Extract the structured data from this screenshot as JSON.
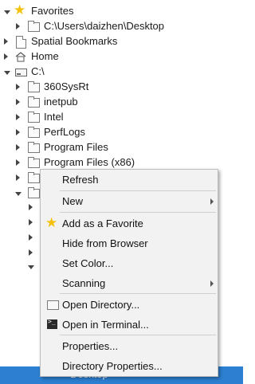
{
  "tree": {
    "favorites_label": "Favorites",
    "desktop_path": "C:\\Users\\daizhen\\Desktop",
    "spatial_bookmarks": "Spatial Bookmarks",
    "home": "Home",
    "drive": "C:\\",
    "folders": [
      "360SysRt",
      "inetpub",
      "Intel",
      "PerfLogs",
      "Program Files",
      "Program Files (x86)"
    ],
    "selected_label": "Desktop"
  },
  "context_menu": {
    "refresh": "Refresh",
    "new": "New",
    "add_favorite": "Add as a Favorite",
    "hide_from_browser": "Hide from Browser",
    "set_color": "Set Color...",
    "scanning": "Scanning",
    "open_directory": "Open Directory...",
    "open_in_terminal": "Open in Terminal...",
    "properties": "Properties...",
    "directory_properties": "Directory Properties..."
  },
  "colors": {
    "selection": "#2d7fd2",
    "star": "#f4c20d"
  }
}
